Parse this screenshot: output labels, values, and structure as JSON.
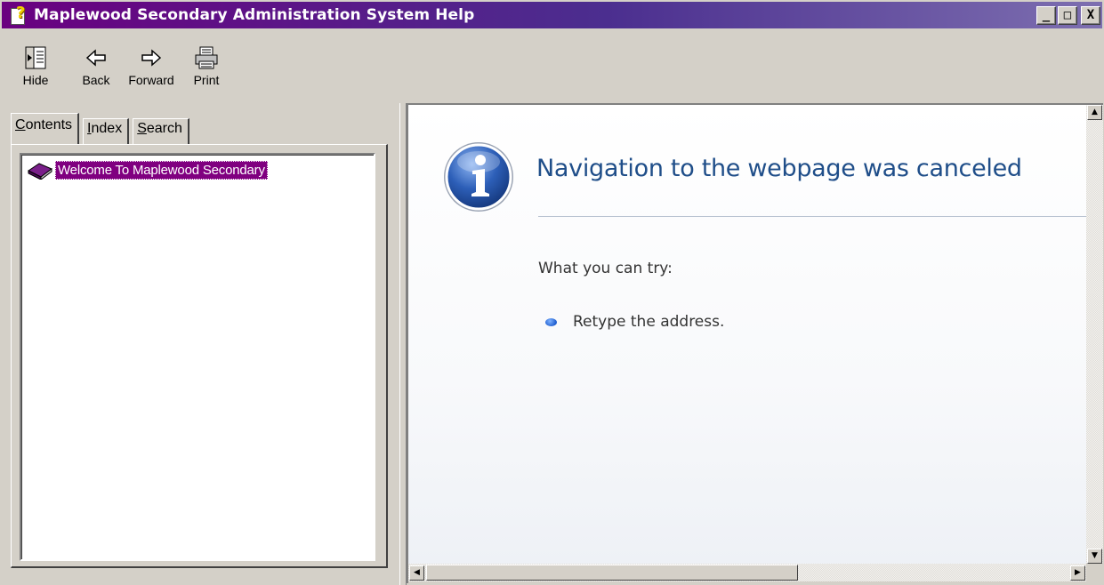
{
  "window": {
    "title": "Maplewood Secondary Administration System Help",
    "controls": {
      "minimize": "_",
      "maximize": "□",
      "close": "X"
    }
  },
  "toolbar": {
    "items": [
      {
        "label": "Hide",
        "icon": "hide-pane-icon"
      },
      {
        "label": "Back",
        "icon": "back-arrow-icon"
      },
      {
        "label": "Forward",
        "icon": "forward-arrow-icon"
      },
      {
        "label": "Print",
        "icon": "printer-icon"
      }
    ]
  },
  "nav": {
    "tabs": [
      {
        "label": "Contents",
        "hotkey": "C",
        "rest": "ontents",
        "active": true
      },
      {
        "label": "Index",
        "hotkey": "I",
        "rest": "ndex",
        "active": false
      },
      {
        "label": "Search",
        "hotkey": "S",
        "rest": "earch",
        "active": false
      }
    ],
    "tree": [
      {
        "label": "Welcome To Maplewood Secondary",
        "icon": "book-icon",
        "selected": true
      }
    ]
  },
  "content": {
    "heading": "Navigation to the webpage was canceled",
    "subheading": "What you can try:",
    "suggestions": [
      "Retype the address."
    ]
  },
  "colors": {
    "title_gradient_start": "#6a0080",
    "selection": "#800080",
    "heading": "#1f4e89"
  }
}
